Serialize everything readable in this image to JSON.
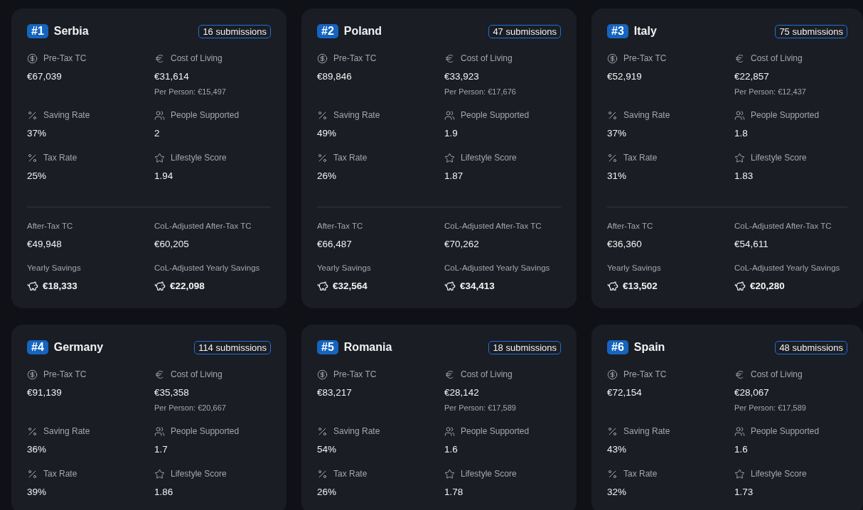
{
  "cards": [
    {
      "rank": "#1",
      "country": "Serbia",
      "submissions": "16 submissions",
      "metrics": [
        {
          "kind": "dollar",
          "label": "Pre-Tax TC",
          "value": "€67,039"
        },
        {
          "kind": "euro",
          "label": "Cost of Living",
          "value": "€31,614",
          "sub": "Per Person: €15,497"
        },
        {
          "kind": "percent",
          "label": "Saving Rate",
          "value": "37%"
        },
        {
          "kind": "people",
          "label": "People Supported",
          "value": "2"
        },
        {
          "kind": "percent",
          "label": "Tax Rate",
          "value": "25%"
        },
        {
          "kind": "star",
          "label": "Lifestyle Score",
          "value": "1.94"
        }
      ],
      "totals": [
        {
          "kind": "plain",
          "label": "After-Tax TC",
          "value": "€49,948"
        },
        {
          "kind": "plain",
          "label": "CoL-Adjusted After-Tax TC",
          "value": "€60,205"
        },
        {
          "kind": "savings",
          "label": "Yearly Savings",
          "value": "€18,333"
        },
        {
          "kind": "savings",
          "label": "CoL-Adjusted Yearly Savings",
          "value": "€22,098"
        }
      ]
    },
    {
      "rank": "#2",
      "country": "Poland",
      "submissions": "47 submissions",
      "metrics": [
        {
          "kind": "dollar",
          "label": "Pre-Tax TC",
          "value": "€89,846"
        },
        {
          "kind": "euro",
          "label": "Cost of Living",
          "value": "€33,923",
          "sub": "Per Person: €17,676"
        },
        {
          "kind": "percent",
          "label": "Saving Rate",
          "value": "49%"
        },
        {
          "kind": "people",
          "label": "People Supported",
          "value": "1.9"
        },
        {
          "kind": "percent",
          "label": "Tax Rate",
          "value": "26%"
        },
        {
          "kind": "star",
          "label": "Lifestyle Score",
          "value": "1.87"
        }
      ],
      "totals": [
        {
          "kind": "plain",
          "label": "After-Tax TC",
          "value": "€66,487"
        },
        {
          "kind": "plain",
          "label": "CoL-Adjusted After-Tax TC",
          "value": "€70,262"
        },
        {
          "kind": "savings",
          "label": "Yearly Savings",
          "value": "€32,564"
        },
        {
          "kind": "savings",
          "label": "CoL-Adjusted Yearly Savings",
          "value": "€34,413"
        }
      ]
    },
    {
      "rank": "#3",
      "country": "Italy",
      "submissions": "75 submissions",
      "metrics": [
        {
          "kind": "dollar",
          "label": "Pre-Tax TC",
          "value": "€52,919"
        },
        {
          "kind": "euro",
          "label": "Cost of Living",
          "value": "€22,857",
          "sub": "Per Person: €12,437"
        },
        {
          "kind": "percent",
          "label": "Saving Rate",
          "value": "37%"
        },
        {
          "kind": "people",
          "label": "People Supported",
          "value": "1.8"
        },
        {
          "kind": "percent",
          "label": "Tax Rate",
          "value": "31%"
        },
        {
          "kind": "star",
          "label": "Lifestyle Score",
          "value": "1.83"
        }
      ],
      "totals": [
        {
          "kind": "plain",
          "label": "After-Tax TC",
          "value": "€36,360"
        },
        {
          "kind": "plain",
          "label": "CoL-Adjusted After-Tax TC",
          "value": "€54,611"
        },
        {
          "kind": "savings",
          "label": "Yearly Savings",
          "value": "€13,502"
        },
        {
          "kind": "savings",
          "label": "CoL-Adjusted Yearly Savings",
          "value": "€20,280"
        }
      ]
    },
    {
      "rank": "#4",
      "country": "Germany",
      "submissions": "114 submissions",
      "metrics": [
        {
          "kind": "dollar",
          "label": "Pre-Tax TC",
          "value": "€91,139"
        },
        {
          "kind": "euro",
          "label": "Cost of Living",
          "value": "€35,358",
          "sub": "Per Person: €20,667"
        },
        {
          "kind": "percent",
          "label": "Saving Rate",
          "value": "36%"
        },
        {
          "kind": "people",
          "label": "People Supported",
          "value": "1.7"
        },
        {
          "kind": "percent",
          "label": "Tax Rate",
          "value": "39%"
        },
        {
          "kind": "star",
          "label": "Lifestyle Score",
          "value": "1.86"
        }
      ]
    },
    {
      "rank": "#5",
      "country": "Romania",
      "submissions": "18 submissions",
      "metrics": [
        {
          "kind": "dollar",
          "label": "Pre-Tax TC",
          "value": "€83,217"
        },
        {
          "kind": "euro",
          "label": "Cost of Living",
          "value": "€28,142",
          "sub": "Per Person: €17,589"
        },
        {
          "kind": "percent",
          "label": "Saving Rate",
          "value": "54%"
        },
        {
          "kind": "people",
          "label": "People Supported",
          "value": "1.6"
        },
        {
          "kind": "percent",
          "label": "Tax Rate",
          "value": "26%"
        },
        {
          "kind": "star",
          "label": "Lifestyle Score",
          "value": "1.78"
        }
      ]
    },
    {
      "rank": "#6",
      "country": "Spain",
      "submissions": "48 submissions",
      "metrics": [
        {
          "kind": "dollar",
          "label": "Pre-Tax TC",
          "value": "€72,154"
        },
        {
          "kind": "euro",
          "label": "Cost of Living",
          "value": "€28,067",
          "sub": "Per Person: €17,589"
        },
        {
          "kind": "percent",
          "label": "Saving Rate",
          "value": "43%"
        },
        {
          "kind": "people",
          "label": "People Supported",
          "value": "1.6"
        },
        {
          "kind": "percent",
          "label": "Tax Rate",
          "value": "32%"
        },
        {
          "kind": "star",
          "label": "Lifestyle Score",
          "value": "1.73"
        }
      ]
    }
  ]
}
